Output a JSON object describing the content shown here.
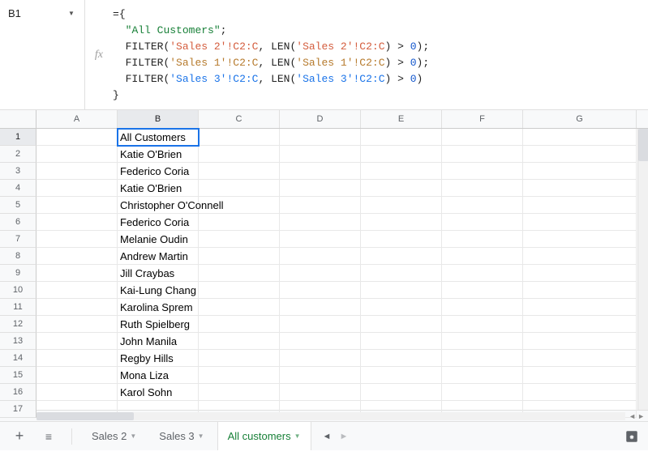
{
  "name_box": {
    "value": "B1"
  },
  "formula": {
    "l1a": "={",
    "l2a": "  ",
    "l2s": "\"All Customers\"",
    "l2b": ";",
    "l3a": "  FILTER(",
    "l3r": "'Sales 2'!C2:C",
    "l3b": ", LEN(",
    "l3r2": "'Sales 2'!C2:C",
    "l3c": ") > ",
    "l3n": "0",
    "l3d": ");",
    "l4a": "  FILTER(",
    "l4r": "'Sales 1'!C2:C",
    "l4b": ", LEN(",
    "l4r2": "'Sales 1'!C2:C",
    "l4c": ") > ",
    "l4n": "0",
    "l4d": ");",
    "l5a": "  FILTER(",
    "l5r": "'Sales 3'!C2:C",
    "l5b": ", LEN(",
    "l5r2": "'Sales 3'!C2:C",
    "l5c": ") > ",
    "l5n": "0",
    "l5d": ")",
    "l6a": "}"
  },
  "columns": [
    "A",
    "B",
    "C",
    "D",
    "E",
    "F",
    "G"
  ],
  "row_numbers": [
    "1",
    "2",
    "3",
    "4",
    "5",
    "6",
    "7",
    "8",
    "9",
    "10",
    "11",
    "12",
    "13",
    "14",
    "15",
    "16",
    "17"
  ],
  "cells_b": [
    "All Customers",
    "Katie O'Brien",
    "Federico Coria",
    "Katie O'Brien",
    "Christopher O'Connell",
    "Federico Coria",
    "Melanie Oudin",
    "Andrew Martin",
    "Jill Craybas",
    "Kai-Lung Chang",
    "Karolina Sprem",
    "Ruth Spielberg",
    "John Manila",
    "Regby Hills",
    "Mona Liza",
    "Karol Sohn",
    ""
  ],
  "tabs": {
    "t1": "Sales 2",
    "t2": "Sales 3",
    "t3": "All customers"
  },
  "fx_label": "fx"
}
